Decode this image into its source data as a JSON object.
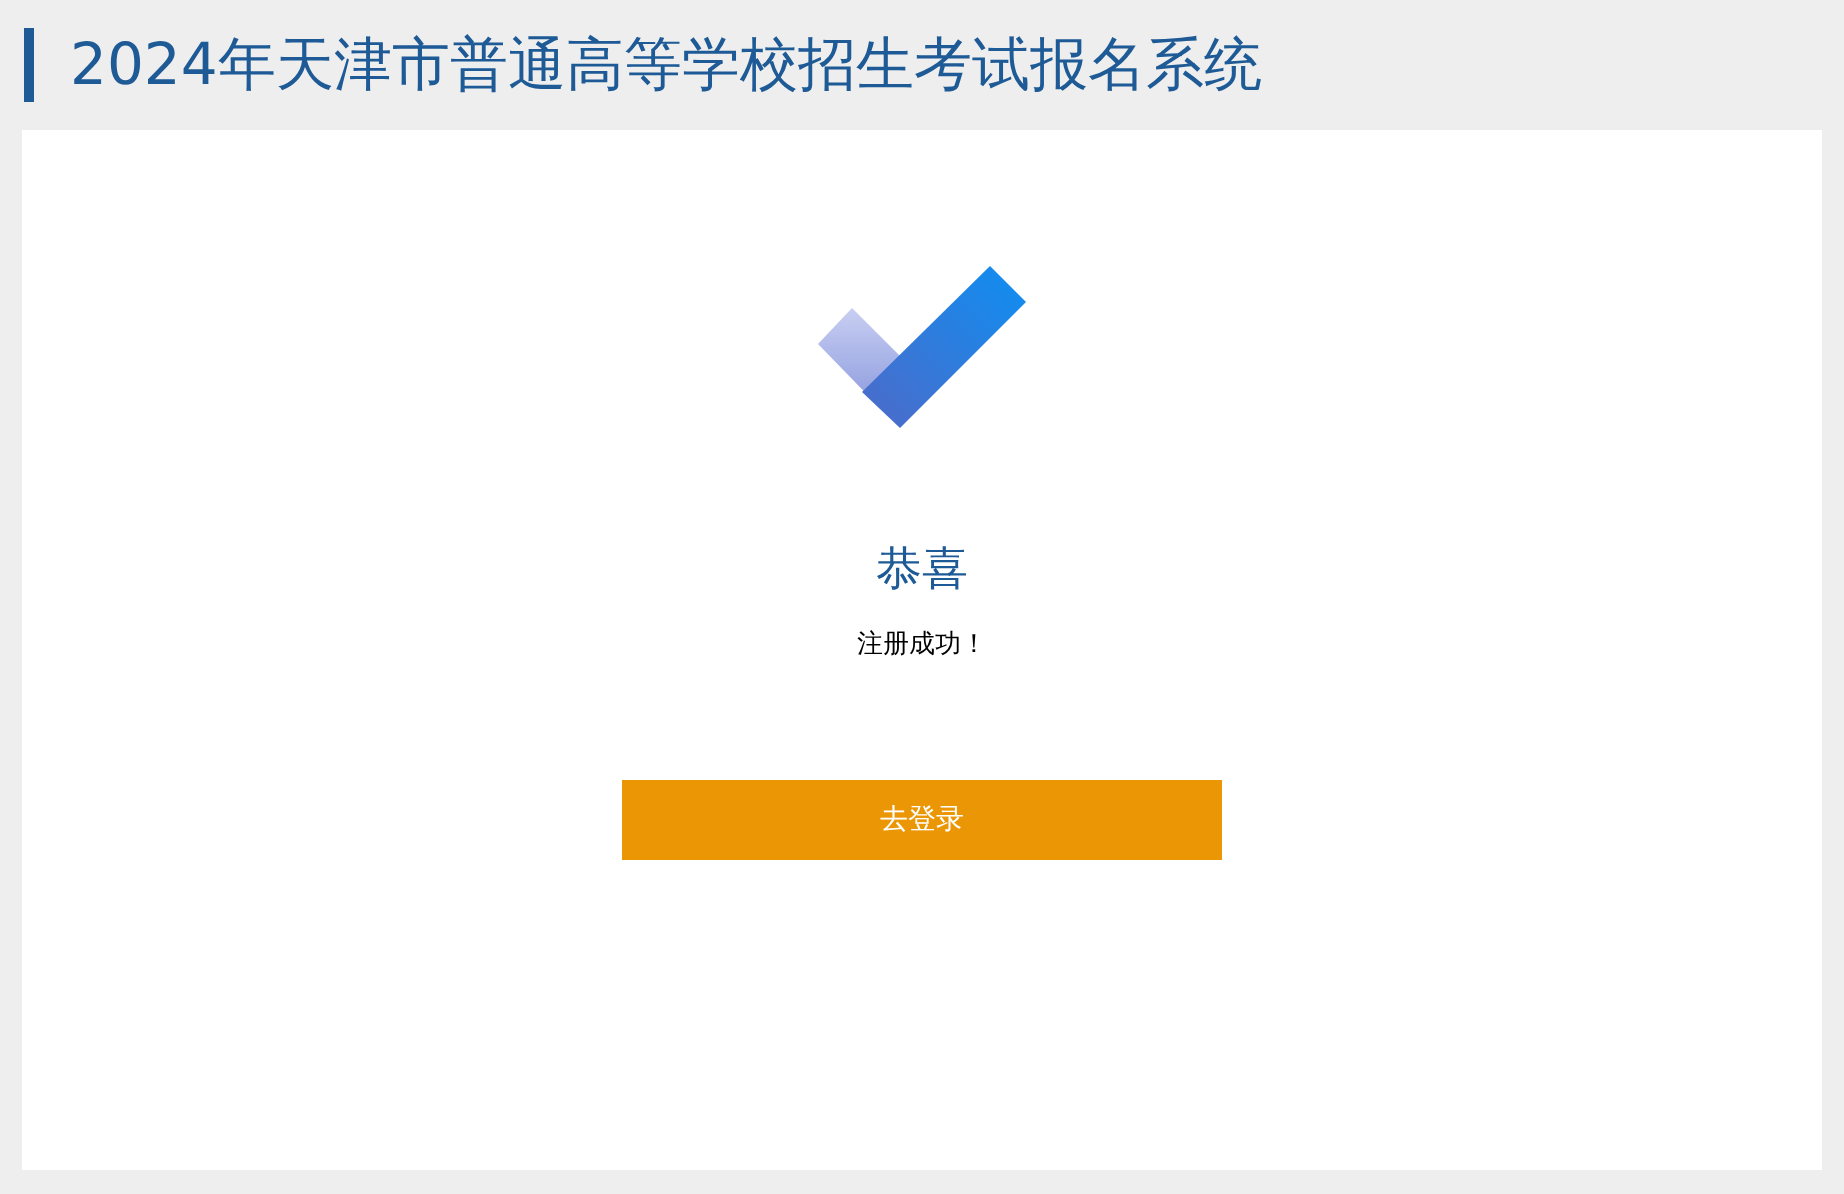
{
  "header": {
    "title": "2024年天津市普通高等学校招生考试报名系统"
  },
  "result": {
    "heading": "恭喜",
    "message": "注册成功！",
    "button": "去登录"
  }
}
